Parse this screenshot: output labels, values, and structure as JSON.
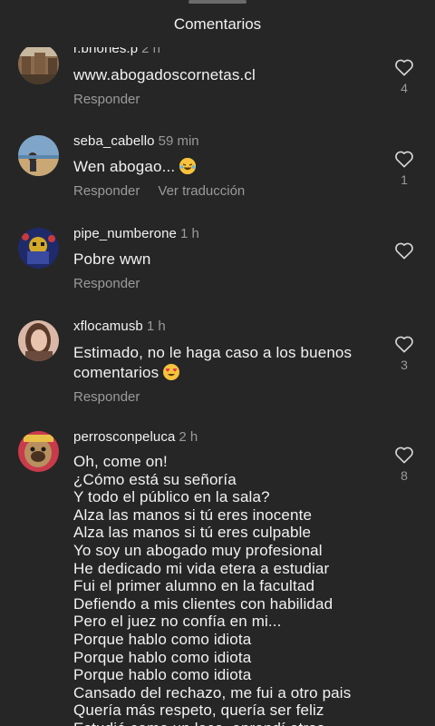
{
  "header": {
    "title": "Comentarios"
  },
  "comments": [
    {
      "user": "r.briones.p",
      "time": "2 h",
      "text": "www.abogadoscornetas.cl",
      "reply": "Responder",
      "likes": "4"
    },
    {
      "user": "seba_cabello",
      "time": "59 min",
      "text": "Wen abogao...",
      "reply": "Responder",
      "translate": "Ver traducción",
      "likes": "1"
    },
    {
      "user": "pipe_numberone",
      "time": "1 h",
      "text": "Pobre wwn",
      "reply": "Responder"
    },
    {
      "user": "xflocamusb",
      "time": "1 h",
      "text": "Estimado, no le haga caso a los buenos\ncomentarios",
      "reply": "Responder",
      "likes": "3"
    },
    {
      "user": "perrosconpeluca",
      "time": "2 h",
      "text": "Oh, come on!\n¿Cómo está su señoría\nY todo el público en la sala?\nAlza las manos si tú eres inocente\nAlza las manos si tú eres culpable\nYo soy un abogado muy profesional\nHe dedicado mi vida etera a estudiar\nFui el primer alumno en la facultad\nDefiendo a mis clientes con habilidad\nPero el juez no confía en mi...\nPorque hablo como idiota\nPorque hablo como idiota\nPorque hablo como idiota\nCansado del rechazo, me fui a otro pais\nQuería más respeto, quería ser feliz\nEstudié como un loco, aprendí otros",
      "likes": "8"
    }
  ],
  "icons": {
    "like": "heart-outline-icon",
    "emoji_laugh": "laughing-tears-emoji",
    "emoji_love": "heart-eyes-emoji"
  }
}
